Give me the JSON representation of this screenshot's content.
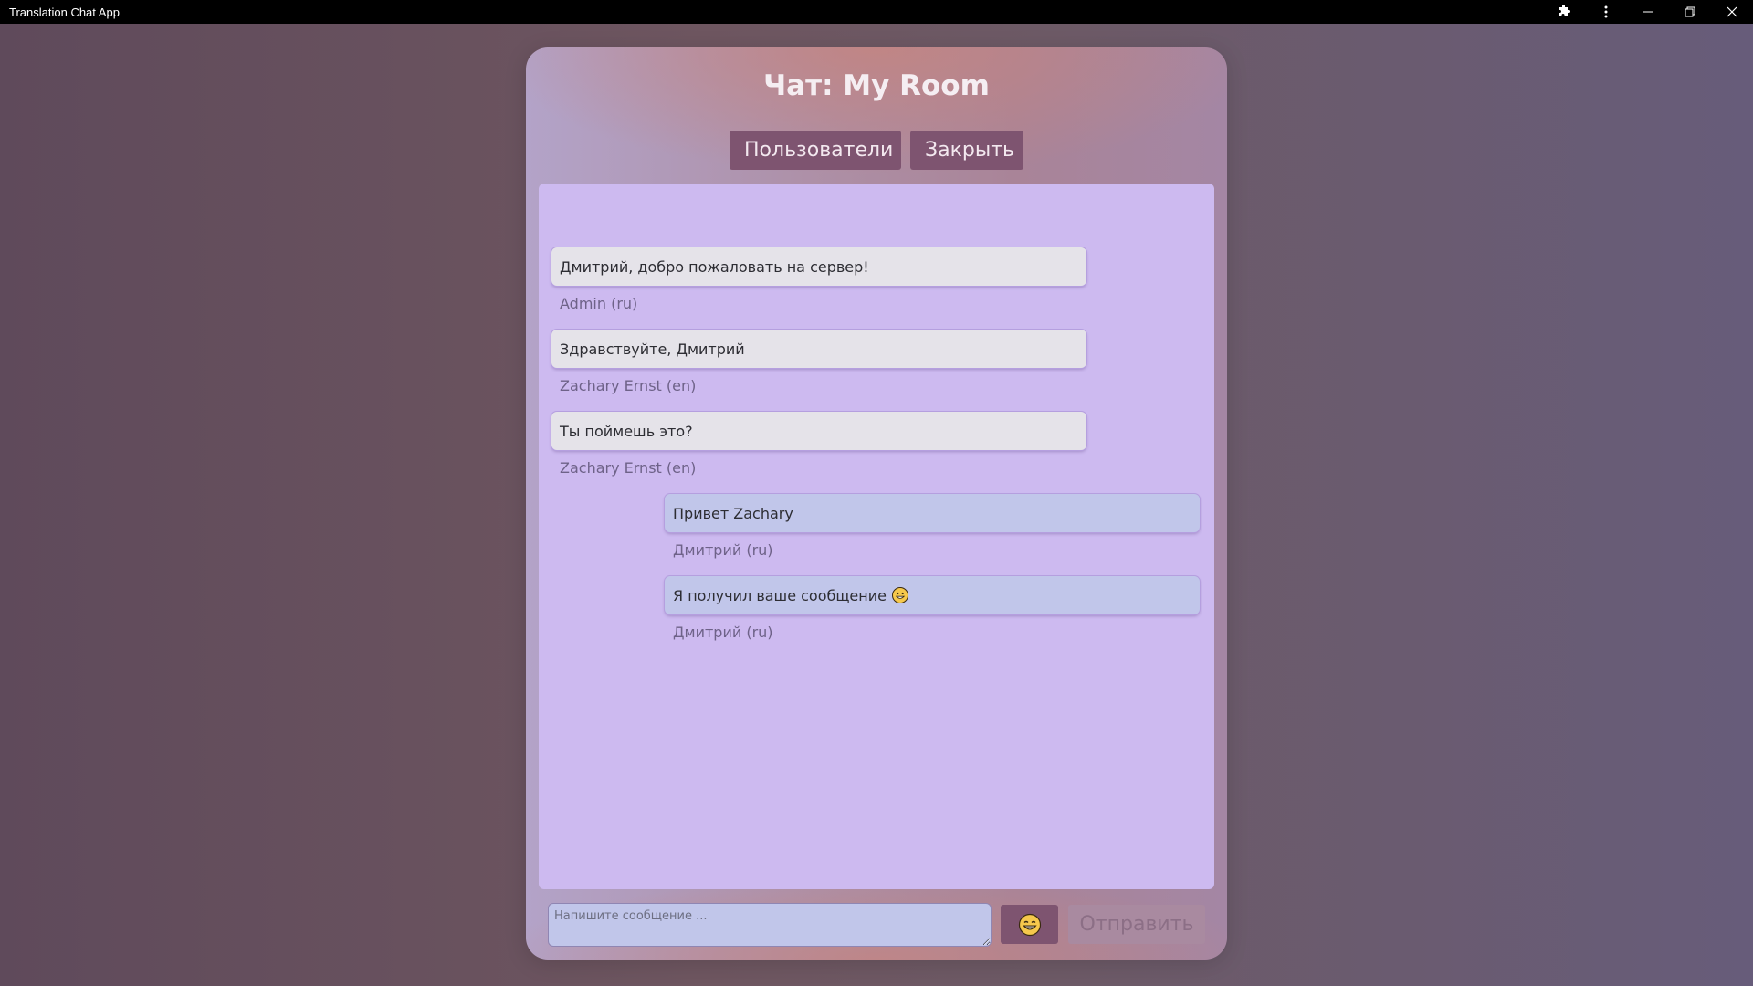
{
  "window": {
    "title": "Translation Chat App"
  },
  "header": {
    "title": "Чат: My Room",
    "users_label": "Пользователи",
    "close_label": "Закрыть"
  },
  "messages": [
    {
      "text": "Дмитрий, добро пожаловать на сервер!",
      "author": "Admin (ru)",
      "direction": "incoming"
    },
    {
      "text": "Здравствуйте, Дмитрий",
      "author": "Zachary Ernst (en)",
      "direction": "incoming"
    },
    {
      "text": "Ты поймешь это?",
      "author": "Zachary Ernst (en)",
      "direction": "incoming"
    },
    {
      "text": "Привет Zachary",
      "author": "Дмитрий (ru)",
      "direction": "outgoing"
    },
    {
      "text": "Я получил ваше сообщение",
      "author": "Дмитрий (ru)",
      "direction": "outgoing",
      "emoji": "grinning-face"
    }
  ],
  "composer": {
    "placeholder": "Напишите сообщение ...",
    "value": "",
    "emoji_icon": "grinning-face-icon",
    "send_label": "Отправить"
  },
  "colors": {
    "accent": "#7e5470",
    "messages_bg": "#cdbaf0",
    "incoming_bubble": "#e5e3e9",
    "outgoing_bubble": "#c1c6ea"
  }
}
